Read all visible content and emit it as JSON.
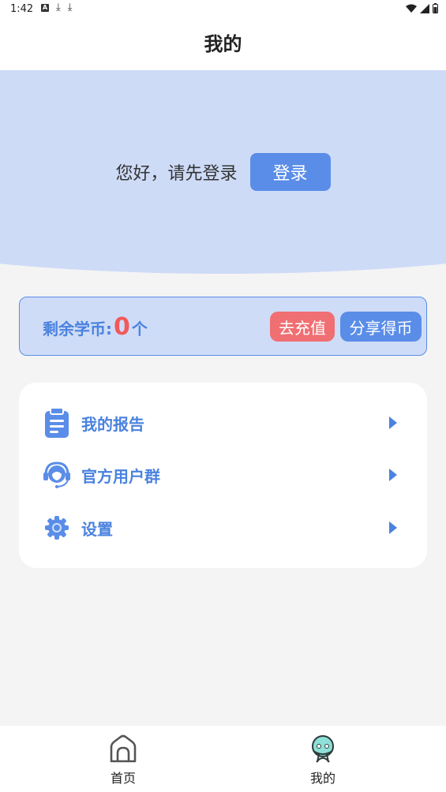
{
  "status_bar": {
    "time": "1:42"
  },
  "header": {
    "title": "我的"
  },
  "hero": {
    "greeting": "您好，请先登录",
    "login_label": "登录"
  },
  "coins": {
    "label": "剩余学币:",
    "value": "0",
    "unit": "个",
    "recharge_label": "去充值",
    "share_label": "分享得币"
  },
  "menu": {
    "items": [
      {
        "label": "我的报告",
        "icon": "clipboard-icon"
      },
      {
        "label": "官方用户群",
        "icon": "headset-icon"
      },
      {
        "label": "设置",
        "icon": "gear-icon"
      }
    ]
  },
  "tabs": [
    {
      "label": "首页",
      "icon": "home-icon"
    },
    {
      "label": "我的",
      "icon": "profile-icon"
    }
  ],
  "colors": {
    "accent": "#5a8de8",
    "hero_bg": "#cedbf7",
    "alert": "#ef6f73",
    "coin_value": "#f05a5a",
    "profile_icon": "#8ee0d8"
  }
}
